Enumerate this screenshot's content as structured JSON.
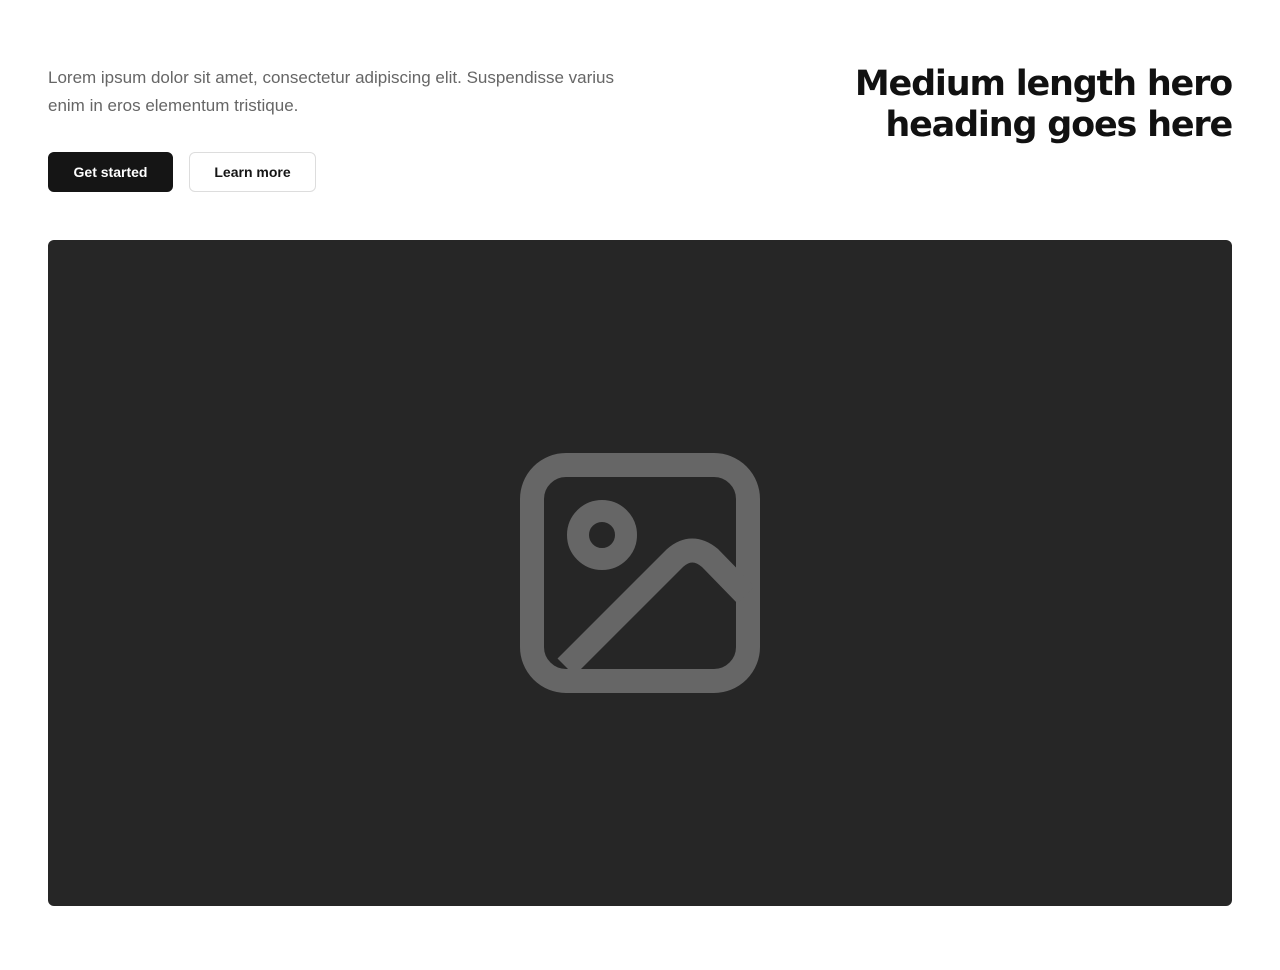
{
  "hero": {
    "description": "Lorem ipsum dolor sit amet, consectetur adipiscing elit. Suspendisse varius enim in eros elementum tristique.",
    "heading_line1": "Medium length hero",
    "heading_line2": "heading goes here",
    "primary_button": "Get started",
    "secondary_button": "Learn more"
  },
  "media": {
    "icon": "image-placeholder-icon",
    "background_color": "#262626",
    "icon_color": "#666666"
  }
}
